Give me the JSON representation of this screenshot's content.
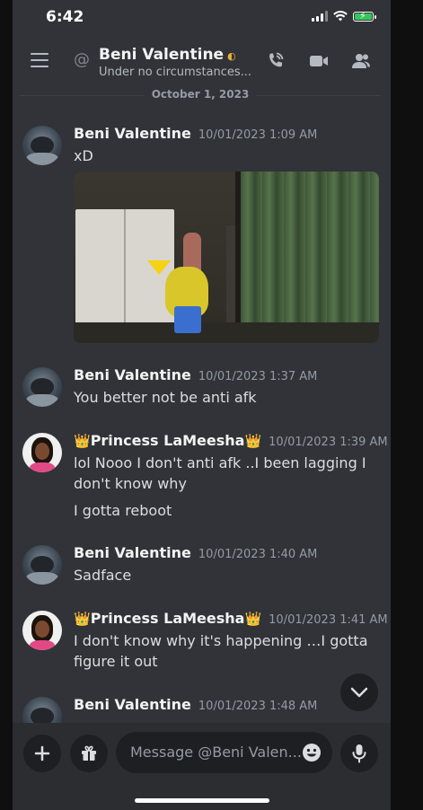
{
  "status_bar": {
    "time": "6:42"
  },
  "header": {
    "title": "Beni Valentine",
    "subtitle": "Under no circumstances...",
    "status_color": "#f0b232"
  },
  "date_divider": "October 1, 2023",
  "messages": [
    {
      "author": "Beni Valentine",
      "timestamp": "10/01/2023 1:09 AM",
      "lines": [
        "xD"
      ],
      "attachment": "image"
    },
    {
      "author": "Beni Valentine",
      "timestamp": "10/01/2023 1:37 AM",
      "lines": [
        "You better not be anti afk"
      ]
    },
    {
      "author": "Princess LaMeesha",
      "author_prefix": "👑",
      "author_suffix": "👑",
      "timestamp": "10/01/2023 1:39 AM",
      "lines": [
        "lol Nooo I don't anti afk ..I been lagging I don't know why",
        "I gotta reboot"
      ]
    },
    {
      "author": "Beni Valentine",
      "timestamp": "10/01/2023 1:40 AM",
      "lines": [
        "Sadface"
      ]
    },
    {
      "author": "Princess LaMeesha",
      "author_prefix": "👑",
      "author_suffix": "👑",
      "timestamp": "10/01/2023 1:41 AM",
      "lines": [
        "I don't know why it's happening …I gotta figure it out"
      ]
    },
    {
      "author": "Beni Valentine",
      "timestamp": "10/01/2023 1:48 AM",
      "lines": []
    }
  ],
  "composer": {
    "placeholder": "Message @Beni Valen..."
  },
  "icons": {
    "menu": "hamburger-menu-icon",
    "dm": "at-icon",
    "call": "phone-call-icon",
    "video": "video-camera-icon",
    "members": "members-icon",
    "jump": "chevron-down-icon",
    "add": "plus-icon",
    "gift": "gift-icon",
    "emoji": "emoji-icon",
    "mic": "microphone-icon"
  },
  "colors": {
    "background": "#313338",
    "composer": "#2b2d31",
    "battery": "#35c759"
  }
}
